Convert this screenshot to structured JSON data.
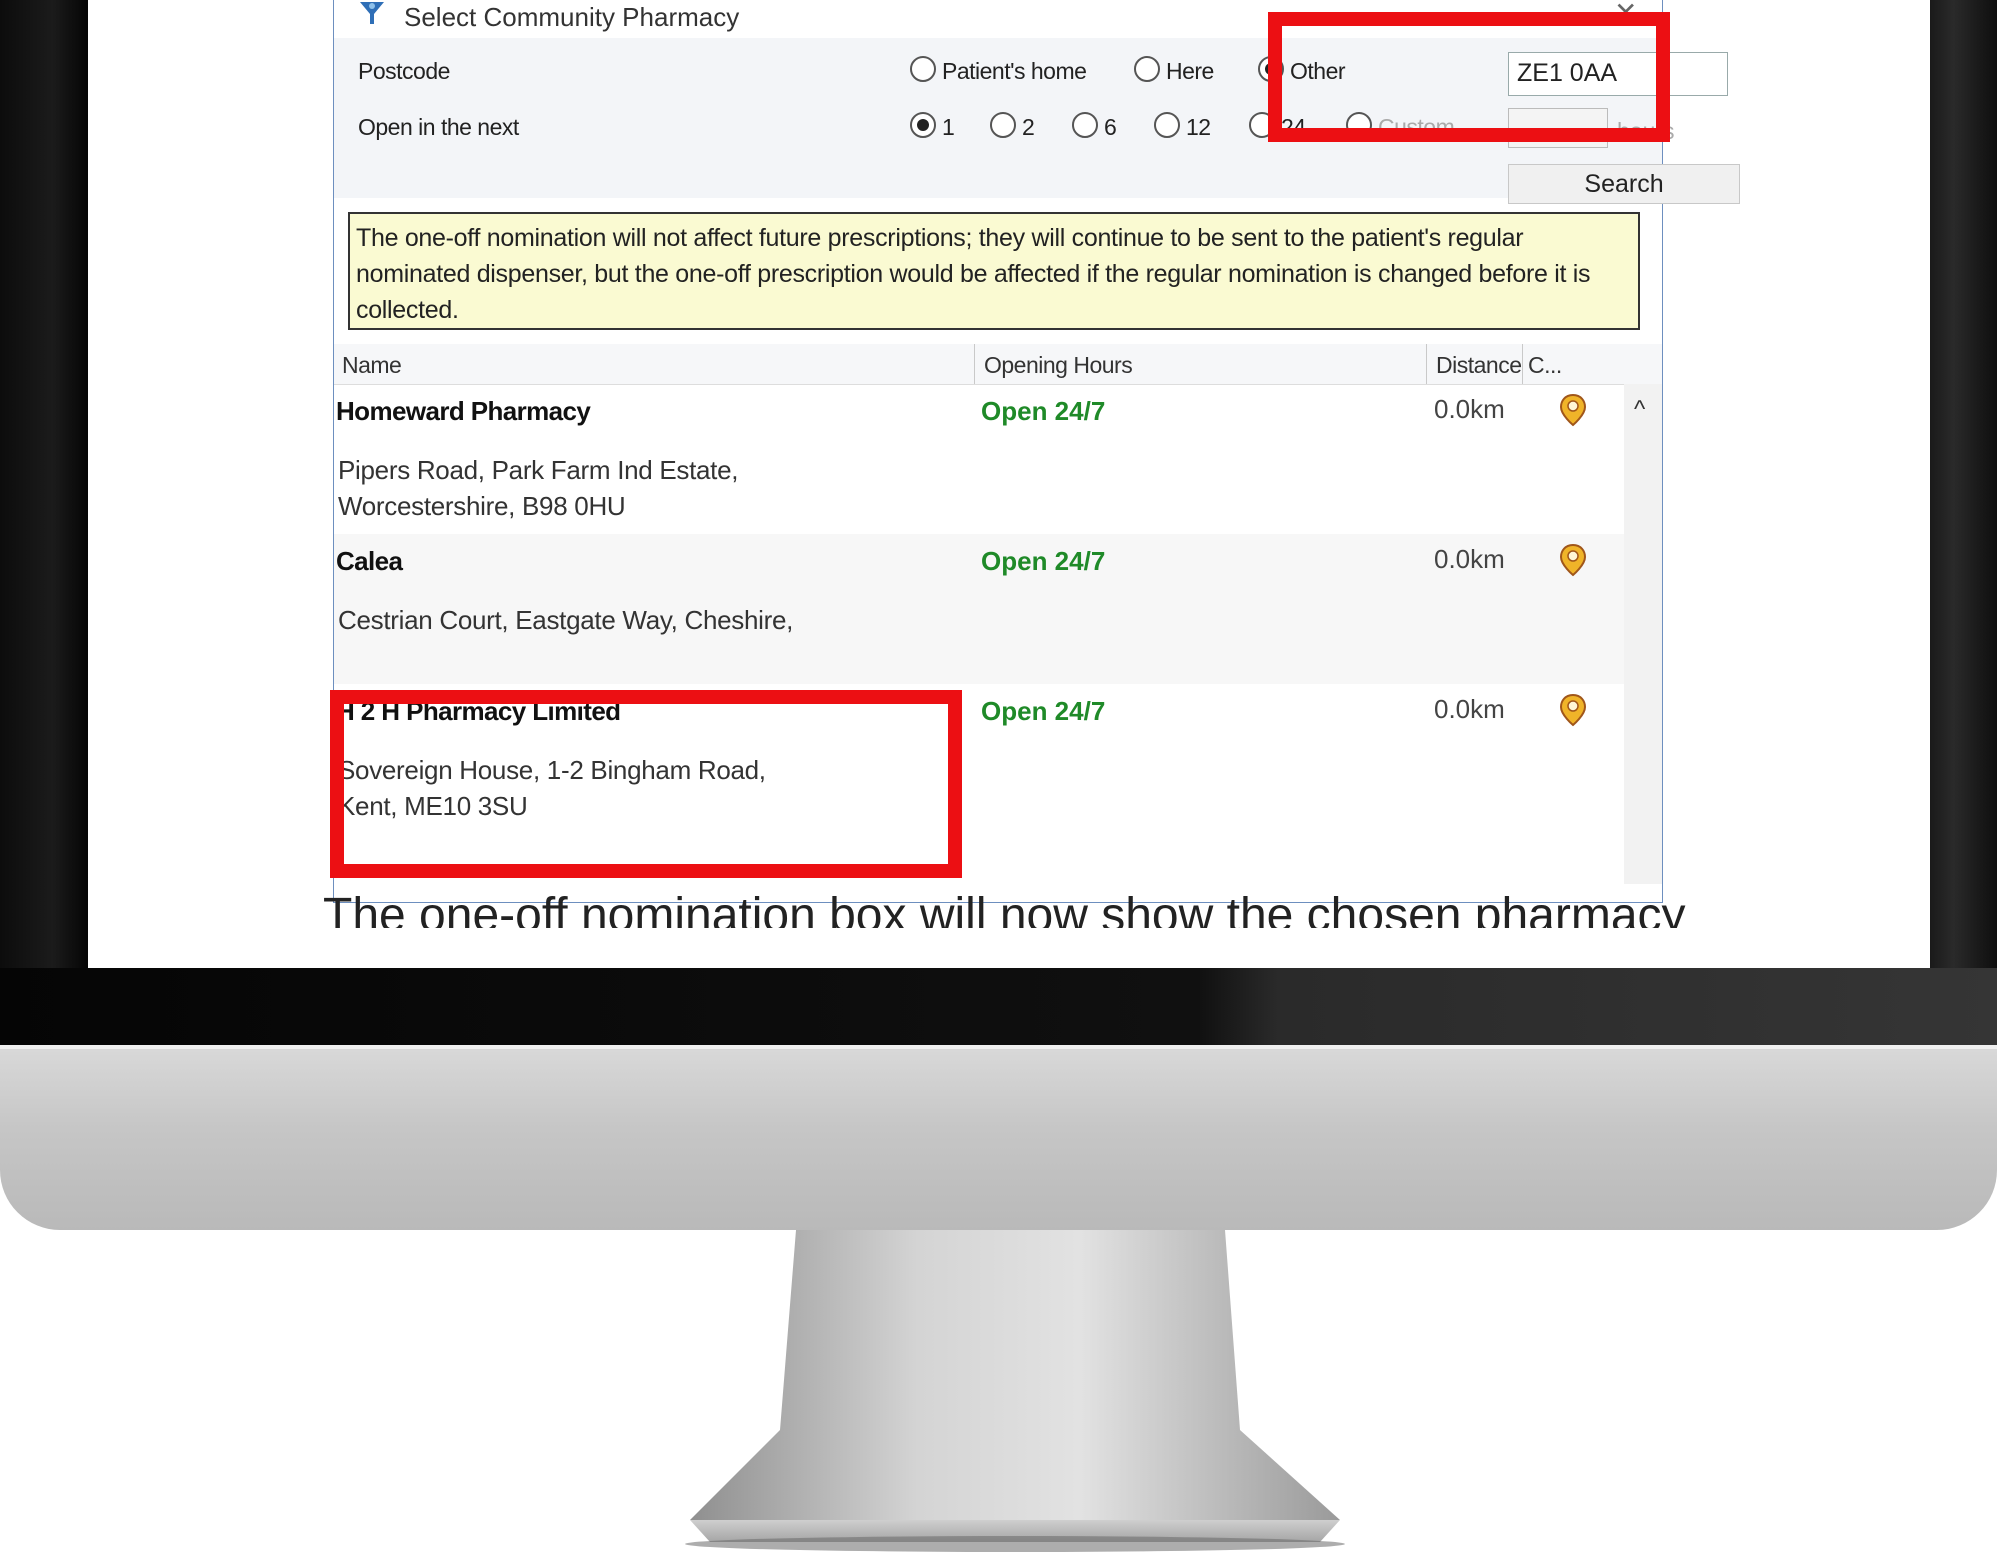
{
  "dialog": {
    "title": "Select Community Pharmacy",
    "postcode_label": "Postcode",
    "postcode_options": [
      {
        "label": "Patient's home",
        "selected": false
      },
      {
        "label": "Here",
        "selected": false
      },
      {
        "label": "Other",
        "selected": true
      }
    ],
    "postcode_value": "ZE1 0AA",
    "open_label": "Open in the next",
    "open_options": [
      {
        "label": "1",
        "selected": true
      },
      {
        "label": "2",
        "selected": false
      },
      {
        "label": "6",
        "selected": false
      },
      {
        "label": "12",
        "selected": false
      },
      {
        "label": "24",
        "selected": false
      },
      {
        "label": "Custom",
        "selected": false
      }
    ],
    "hours_label": "hours",
    "search_label": "Search",
    "notice": "The one-off nomination will not affect future prescriptions; they will continue to be sent to the patient's regular nominated dispenser, but the one-off prescription would be affected if the regular nomination is changed before it is collected.",
    "columns": {
      "name": "Name",
      "hours": "Opening Hours",
      "distance": "Distance",
      "c": "C..."
    },
    "pharmacies": [
      {
        "name": "Homeward Pharmacy",
        "hours": "Open 24/7",
        "distance": "0.0km",
        "address1": "Pipers Road, Park Farm Ind Estate,",
        "address2": "Worcestershire, B98 0HU"
      },
      {
        "name": "Calea",
        "hours": "Open 24/7",
        "distance": "0.0km",
        "address1": "Cestrian Court, Eastgate Way, Cheshire,",
        "address2": ""
      },
      {
        "name": "H 2 H Pharmacy Limited",
        "hours": "Open 24/7",
        "distance": "0.0km",
        "address1": "Sovereign House, 1-2 Bingham Road,",
        "address2": "Kent, ME10 3SU"
      }
    ]
  },
  "caption": "The one-off nomination box will now show the chosen pharmacy",
  "colors": {
    "highlight": "#ec0f13",
    "open_text": "#1f8a28",
    "notice_bg": "#fafad2"
  }
}
